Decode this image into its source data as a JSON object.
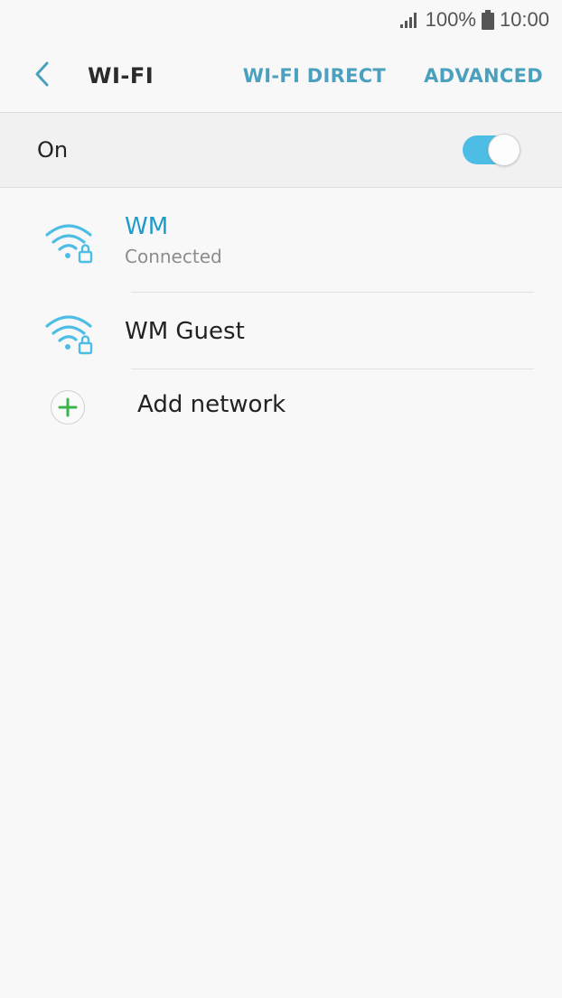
{
  "status_bar": {
    "battery_percent": "100%",
    "time": "10:00",
    "icons": [
      "signal-icon",
      "battery-icon"
    ]
  },
  "header": {
    "title": "WI-FI",
    "actions": [
      "WI-FI DIRECT",
      "ADVANCED"
    ],
    "back_icon": "chevron-left-icon"
  },
  "master_switch": {
    "label": "On",
    "state": "on",
    "accent_color": "#4dbde6"
  },
  "networks": [
    {
      "name": "WM",
      "status": "Connected",
      "secured": true,
      "icon": "wifi-lock-icon"
    },
    {
      "name": "WM Guest",
      "status": "",
      "secured": true,
      "icon": "wifi-lock-icon"
    }
  ],
  "add_network": {
    "label": "Add network",
    "icon": "plus-icon"
  },
  "colors": {
    "accent": "#4aa0bd",
    "connected_name": "#1e9cc9",
    "wifi_icon": "#4dbde6",
    "add_icon": "#3ab54a"
  }
}
